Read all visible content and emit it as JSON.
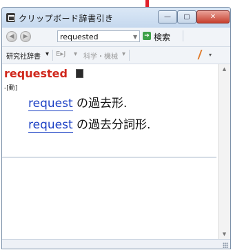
{
  "window": {
    "title": "クリップボード辞書引き",
    "controls": {
      "minimize": "—",
      "maximize": "▢",
      "close": "✕"
    }
  },
  "toolbar": {
    "search_value": "requested",
    "search_button_label": "検索",
    "dictionary_label": "研究社辞書",
    "direction_label": "E▸J",
    "field_label": "科学・機械"
  },
  "entry": {
    "headword": "requested",
    "part_of_speech": "-[動]",
    "definitions": [
      {
        "link": "request",
        "text": "の過去形."
      },
      {
        "link": "request",
        "text": "の過去分詞形."
      }
    ]
  },
  "colors": {
    "headword": "#d0271c",
    "link": "#1a3fc4",
    "accent_arrow": "#e0202a"
  }
}
